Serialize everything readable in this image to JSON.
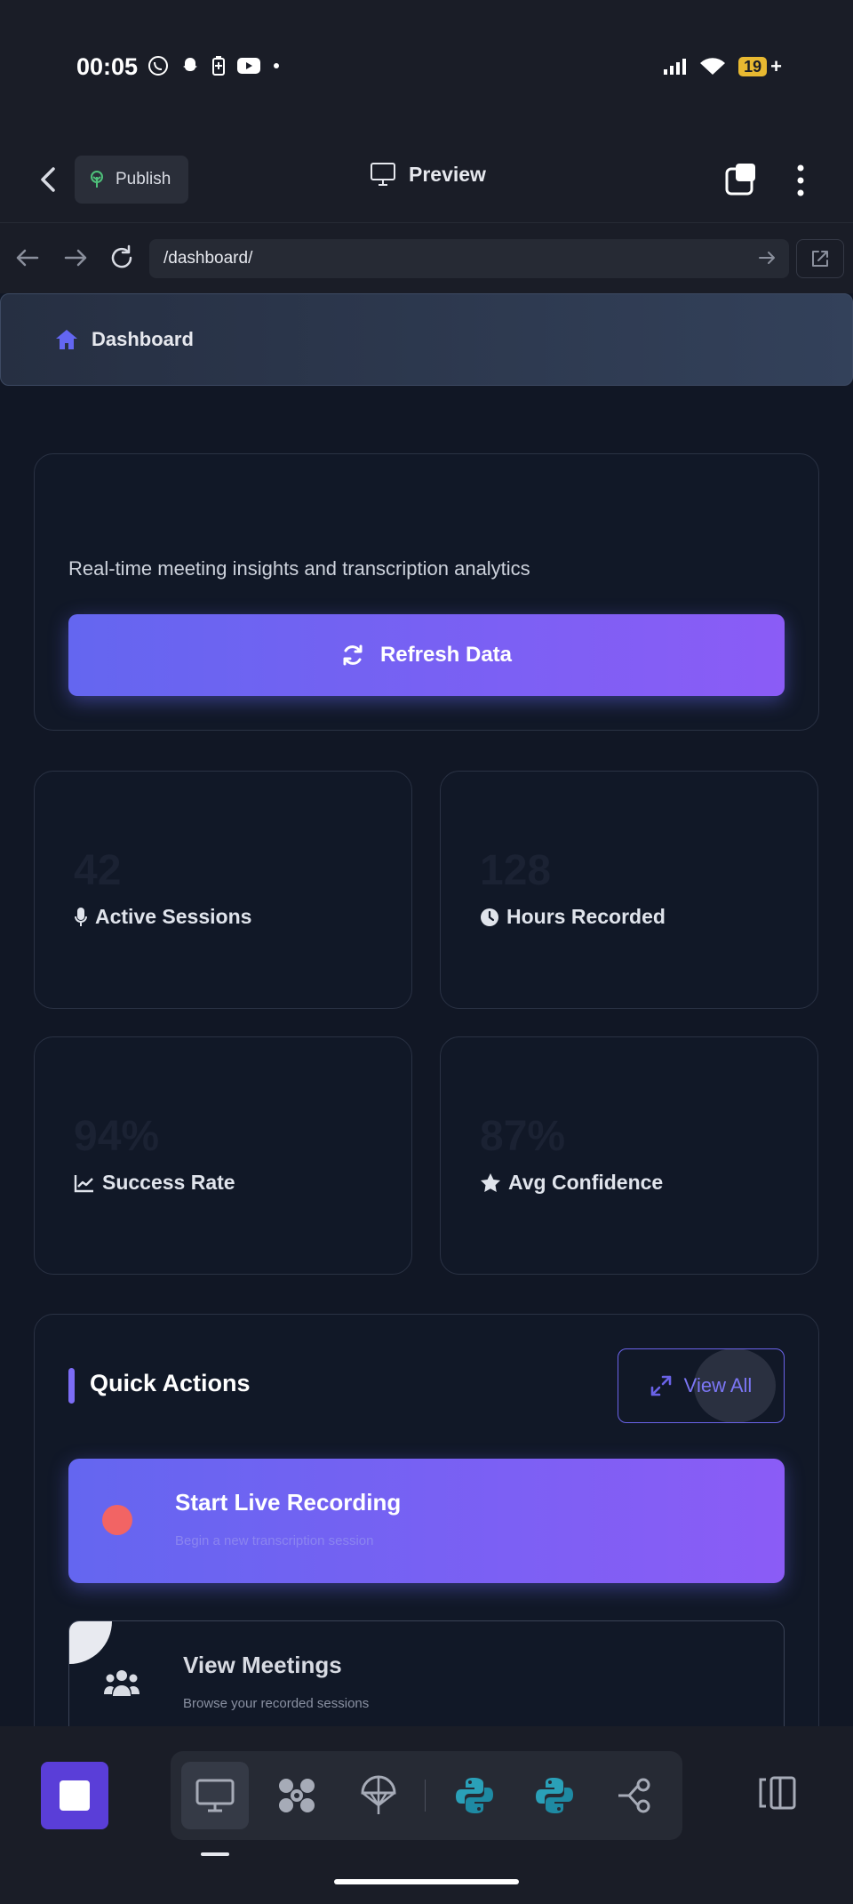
{
  "status_bar": {
    "time": "00:05",
    "battery_level": "19"
  },
  "app_toolbar": {
    "publish_label": "Publish",
    "preview_label": "Preview"
  },
  "browser": {
    "url": "/dashboard/"
  },
  "dashboard_header": {
    "title": "Dashboard"
  },
  "hero": {
    "subtitle": "Real-time meeting insights and transcription analytics",
    "refresh_label": "Refresh Data"
  },
  "stats": [
    {
      "value": "42",
      "label": "Active Sessions",
      "icon": "microphone-icon"
    },
    {
      "value": "128",
      "label": "Hours Recorded",
      "icon": "clock-icon"
    },
    {
      "value": "94%",
      "label": "Success Rate",
      "icon": "chart-line-icon"
    },
    {
      "value": "87%",
      "label": "Avg Confidence",
      "icon": "star-icon"
    }
  ],
  "quick_actions": {
    "title": "Quick Actions",
    "view_all_label": "View All",
    "actions": [
      {
        "title": "Start Live Recording",
        "subtitle": "Begin a new transcription session"
      },
      {
        "title": "View Meetings",
        "subtitle": "Browse your recorded sessions"
      }
    ]
  },
  "colors": {
    "accent_start": "#6466f0",
    "accent_end": "#8b5cf6",
    "record_dot": "#f26464",
    "stop_button": "#5a3ed8"
  }
}
